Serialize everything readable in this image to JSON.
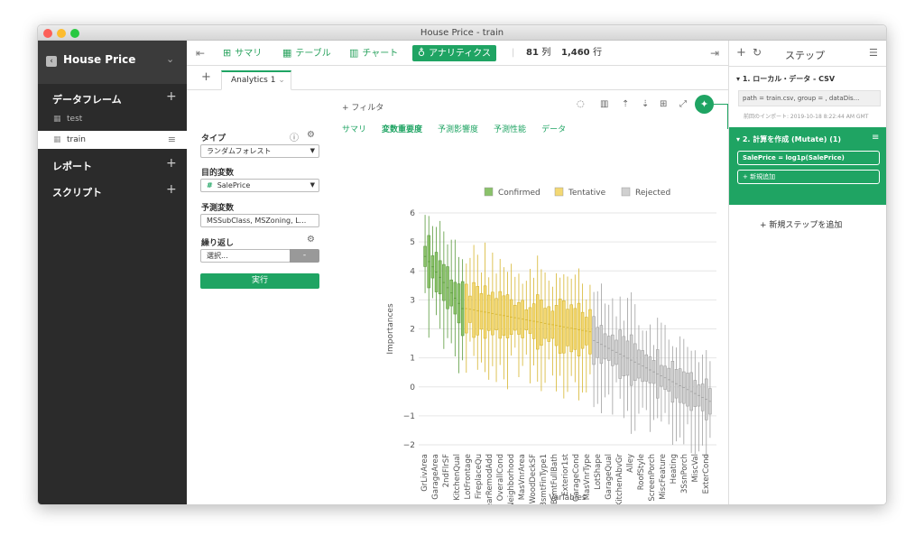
{
  "window": {
    "title": "House Price - train"
  },
  "sidebar": {
    "project": "House Price",
    "sections": {
      "dataframes": "データフレーム",
      "reports": "レポート",
      "scripts": "スクリプト"
    },
    "datasets": [
      {
        "name": "test"
      },
      {
        "name": "train"
      }
    ]
  },
  "toolbar": {
    "summary": "サマリ",
    "table": "テーブル",
    "chart": "チャート",
    "analytics": "アナリティクス",
    "cols": "81",
    "cols_unit": "列",
    "rows": "1,460",
    "rows_unit": "行"
  },
  "tab": {
    "label": "Analytics 1"
  },
  "form": {
    "type_label": "タイプ",
    "type_value": "ランダムフォレスト",
    "target_label": "目的変数",
    "target_value": "SalePrice",
    "predictors_label": "予測変数",
    "predictors_value": "MSSubClass, MSZoning, L...",
    "repeat_label": "繰り返し",
    "repeat_value": "選択...",
    "repeat_btn": "-",
    "run": "実行"
  },
  "main": {
    "filter": "フィルタ",
    "subtabs": [
      "サマリ",
      "変数重要度",
      "予測影響度",
      "予測性能",
      "データ"
    ],
    "active_subtab": 1
  },
  "legend": [
    {
      "name": "Confirmed",
      "color": "#8ac26a"
    },
    {
      "name": "Tentative",
      "color": "#f3d873"
    },
    {
      "name": "Rejected",
      "color": "#d0d0d0"
    }
  ],
  "chart_data": {
    "type": "box",
    "xlabel": "Variables",
    "ylabel": "Importances",
    "ylim": [
      -2,
      6
    ],
    "yticks": [
      -2,
      -1,
      0,
      1,
      2,
      3,
      4,
      5,
      6
    ],
    "labeled_categories": [
      "GrLivArea",
      "GarageArea",
      "2ndFlrSF",
      "KitchenQual",
      "LotFrontage",
      "FireplaceQu",
      "YearRemodAdd",
      "OverallCond",
      "Neighborhood",
      "MasVnrArea",
      "WoodDeckSF",
      "BsmtFinType1",
      "BsmtFullBath",
      "Exterior1st",
      "GarageCond",
      "MasVnrType",
      "LotShape",
      "GarageQual",
      "KitchenAbvGr",
      "Alley",
      "RoofStyle",
      "ScreenPorch",
      "MiscFeature",
      "Heating",
      "3SsnPorch",
      "MiscVal",
      "ExterCond"
    ],
    "groups": [
      {
        "status": "Confirmed",
        "count": 11,
        "median_from": 4.5,
        "median_to": 2.7
      },
      {
        "status": "Tentative",
        "count": 34,
        "median_from": 2.7,
        "median_to": 1.9
      },
      {
        "status": "Rejected",
        "count": 32,
        "median_from": 1.6,
        "median_to": -0.5
      }
    ]
  },
  "right": {
    "header": "ステップ",
    "step1_title": "1. ローカル・データ - CSV",
    "step1_code": "path = train.csv, group = , dataDis...",
    "step1_note": "前回のインポート: 2019-10-18 8:22:44 AM GMT",
    "step2_title": "2. 計算を作成 (Mutate) (1)",
    "step2_code": "SalePrice = log1p(SalePrice)",
    "step2_add": "+ 新規追加",
    "add_step": "新規ステップを追加"
  },
  "colors": {
    "green": "#1fa463",
    "sidebar": "#2b2b2b"
  }
}
